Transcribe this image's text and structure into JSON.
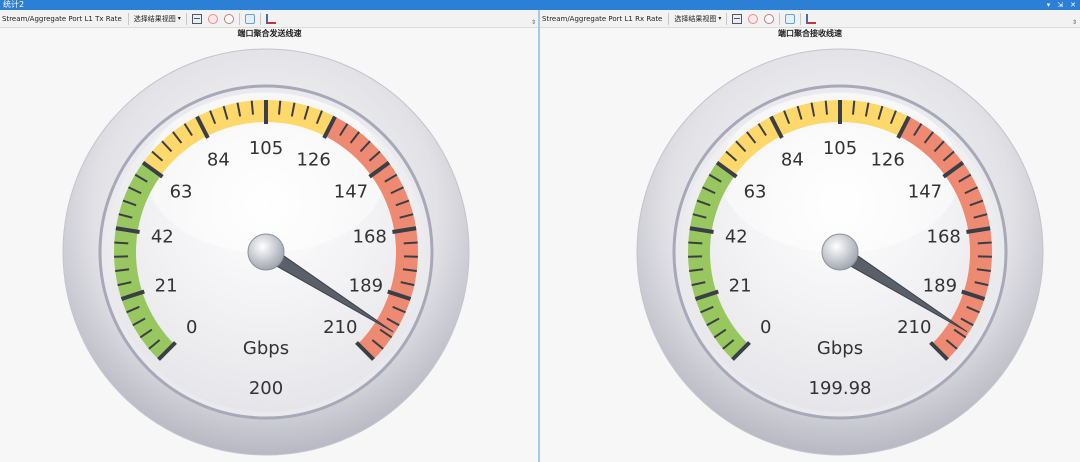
{
  "window": {
    "title": "统计2",
    "controls": [
      "▾",
      "⇲",
      "✕"
    ]
  },
  "panels": [
    {
      "toolbar": {
        "stat_label": "Stream/Aggregate Port L1 Tx Rate",
        "view_select": "选择结果视图",
        "view_arrow": "▾"
      },
      "chart_title": "端口聚合发送线速",
      "corner_mark": "⇕"
    },
    {
      "toolbar": {
        "stat_label": "Stream/Aggregate Port L1 Rx Rate",
        "view_select": "选择结果视图",
        "view_arrow": "▾"
      },
      "chart_title": "端口聚合接收线速",
      "corner_mark": "⇕"
    }
  ],
  "chart_data": [
    {
      "type": "gauge",
      "title": "端口聚合发送线速",
      "min": 0,
      "max": 210,
      "ticks": [
        "0",
        "21",
        "42",
        "63",
        "84",
        "105",
        "126",
        "147",
        "168",
        "189",
        "210"
      ],
      "unit": "Gbps",
      "value": 200,
      "value_label": "200",
      "bands": [
        {
          "from": 0,
          "to": 63,
          "color": "#98c75f"
        },
        {
          "from": 63,
          "to": 126,
          "color": "#ffd86b"
        },
        {
          "from": 126,
          "to": 210,
          "color": "#ef8a72"
        }
      ]
    },
    {
      "type": "gauge",
      "title": "端口聚合接收线速",
      "min": 0,
      "max": 210,
      "ticks": [
        "0",
        "21",
        "42",
        "63",
        "84",
        "105",
        "126",
        "147",
        "168",
        "189",
        "210"
      ],
      "unit": "Gbps",
      "value": 199.98,
      "value_label": "199.98",
      "bands": [
        {
          "from": 0,
          "to": 63,
          "color": "#98c75f"
        },
        {
          "from": 63,
          "to": 126,
          "color": "#ffd86b"
        },
        {
          "from": 126,
          "to": 210,
          "color": "#ef8a72"
        }
      ]
    }
  ]
}
